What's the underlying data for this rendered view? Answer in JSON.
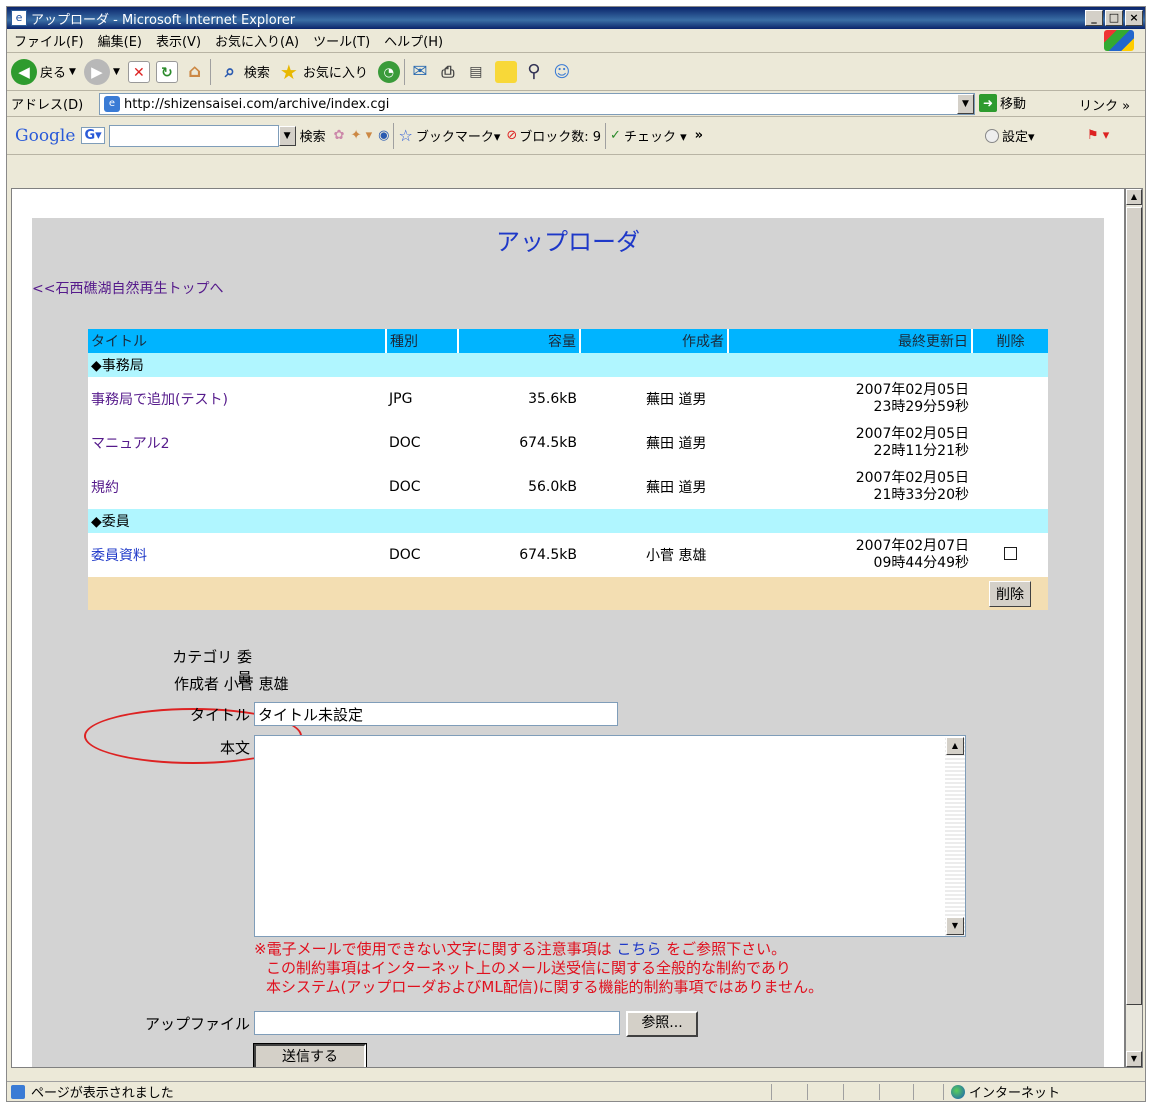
{
  "window": {
    "title": "アップローダ - Microsoft Internet Explorer",
    "min": "_",
    "max": "□",
    "close": "×"
  },
  "menu": [
    "ファイル(F)",
    "編集(E)",
    "表示(V)",
    "お気に入り(A)",
    "ツール(T)",
    "ヘルプ(H)"
  ],
  "toolbar": {
    "back": "戻る",
    "search": "検索",
    "favorites": "お気に入り"
  },
  "address": {
    "label": "アドレス(D)",
    "url": "http://shizensaisei.com/archive/index.cgi",
    "go": "移動",
    "links": "リンク »"
  },
  "google": {
    "logo": "Google",
    "g_button": "G▾",
    "search": "検索",
    "bookmark": "ブックマーク▾",
    "blocked": "ブロック数: 9",
    "check": "チェック ▾",
    "more": "»",
    "settings": "設定▾"
  },
  "page": {
    "title": "アップローダ",
    "back_link": "<<石西礁湖自然再生トップへ"
  },
  "table": {
    "headers": [
      "タイトル",
      "種別",
      "容量",
      "作成者",
      "最終更新日",
      "削除"
    ],
    "category1": "◆事務局",
    "category2": "◆委員",
    "rows": [
      {
        "title": "事務局で追加(テスト)",
        "type": "JPG",
        "size": "35.6kB",
        "author": "蕪田 道男",
        "date1": "2007年02月05日",
        "date2": "23時29分59秒"
      },
      {
        "title": "マニュアル2",
        "type": "DOC",
        "size": "674.5kB",
        "author": "蕪田 道男",
        "date1": "2007年02月05日",
        "date2": "22時11分21秒"
      },
      {
        "title": "規約",
        "type": "DOC",
        "size": "56.0kB",
        "author": "蕪田 道男",
        "date1": "2007年02月05日",
        "date2": "21時33分20秒"
      },
      {
        "title": "委員資料",
        "type": "DOC",
        "size": "674.5kB",
        "author": "小菅 恵雄",
        "date1": "2007年02月07日",
        "date2": "09時44分49秒"
      }
    ],
    "delete_button": "削除"
  },
  "form": {
    "category_label": "カテゴリ",
    "category_value": "委員",
    "author_label": "作成者",
    "author_value": "小菅 恵雄",
    "title_label": "タイトル",
    "title_value": "タイトル未設定",
    "body_label": "本文",
    "note1a": "※電子メールで使用できない文字に関する注意事項は ",
    "note1link": "こちら",
    "note1b": " をご参照下さい。",
    "note2": "この制約事項はインターネット上のメール送受信に関する全般的な制約であり",
    "note3": "本システム(アップローダおよびML配信)に関する機能的制約事項ではありません。",
    "file_label": "アップファイル",
    "browse": "参照...",
    "submit": "送信する"
  },
  "status": {
    "text": "ページが表示されました",
    "zone": "インターネット"
  }
}
